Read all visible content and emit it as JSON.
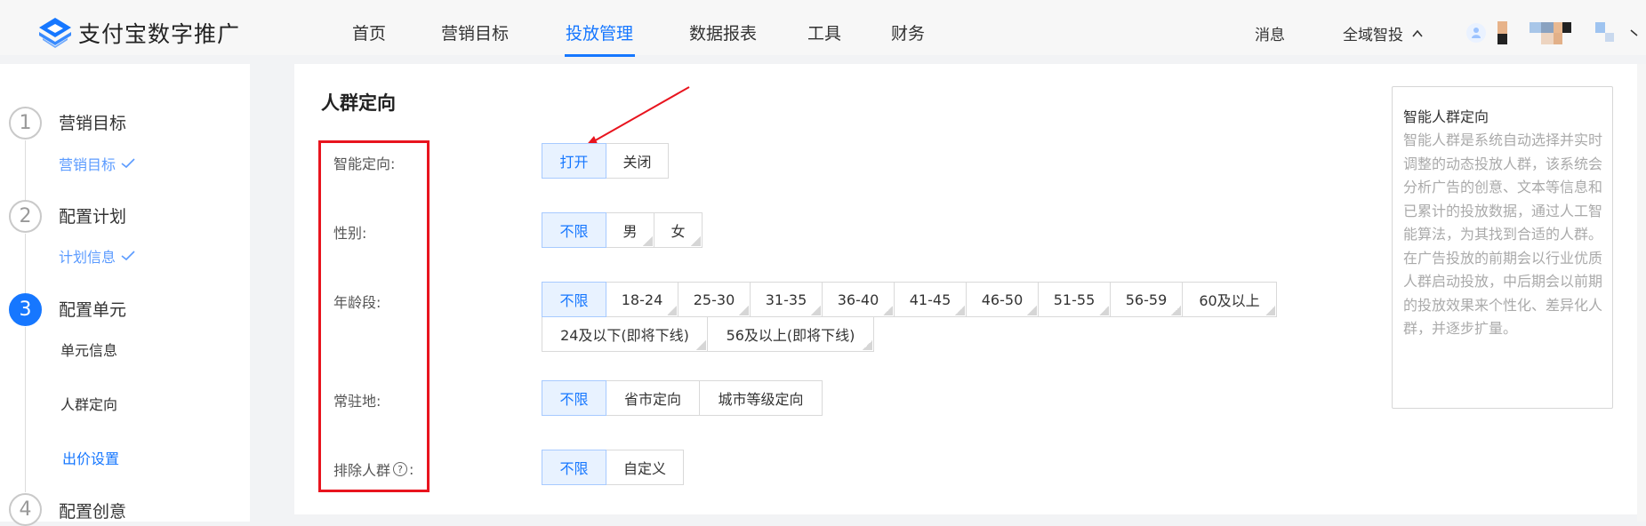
{
  "app": {
    "name": "支付宝数字推广"
  },
  "nav": {
    "items": [
      {
        "label": "首页",
        "active": false
      },
      {
        "label": "营销目标",
        "active": false
      },
      {
        "label": "投放管理",
        "active": true
      },
      {
        "label": "数据报表",
        "active": false
      },
      {
        "label": "工具",
        "active": false
      },
      {
        "label": "财务",
        "active": false
      }
    ],
    "messages": "消息",
    "scope": "全域智投",
    "scope_icon": "chevron-up-icon"
  },
  "colors": {
    "accent": "#1677ff",
    "highlight": "#e8141e",
    "accent_bg": "#e8f2ff"
  },
  "steps": [
    {
      "number": "1",
      "title": "营销目标",
      "state": "done",
      "subs": [
        {
          "label": "营销目标",
          "state": "done"
        }
      ]
    },
    {
      "number": "2",
      "title": "配置计划",
      "state": "done",
      "subs": [
        {
          "label": "计划信息",
          "state": "done"
        }
      ]
    },
    {
      "number": "3",
      "title": "配置单元",
      "state": "active",
      "subs": [
        {
          "label": "单元信息",
          "state": "normal"
        },
        {
          "label": "人群定向",
          "state": "normal"
        },
        {
          "label": "出价设置",
          "state": "link"
        }
      ]
    },
    {
      "number": "4",
      "title": "配置创意",
      "state": "pending",
      "subs": []
    }
  ],
  "section": {
    "title": "人群定向",
    "rows": {
      "smart": {
        "label": "智能定向:",
        "options": [
          "打开",
          "关闭"
        ],
        "selected": "打开"
      },
      "gender": {
        "label": "性别:",
        "options": [
          "不限",
          "男",
          "女"
        ],
        "selected": "不限"
      },
      "age": {
        "label": "年龄段:",
        "options": [
          "不限",
          "18-24",
          "25-30",
          "31-35",
          "36-40",
          "41-45",
          "46-50",
          "51-55",
          "56-59",
          "60及以上"
        ],
        "options_row2": [
          "24及以下(即将下线)",
          "56及以上(即将下线)"
        ],
        "selected": "不限"
      },
      "residence": {
        "label": "常驻地:",
        "options": [
          "不限",
          "省市定向",
          "城市等级定向"
        ],
        "selected": "不限"
      },
      "exclude": {
        "label_text": "排除人群",
        "label_suffix": ":",
        "help_glyph": "?",
        "options": [
          "不限",
          "自定义"
        ],
        "selected": "不限"
      }
    }
  },
  "help_panel": {
    "title": "智能人群定向",
    "body": "智能人群是系统自动选择并实时调整的动态投放人群，该系统会分析广告的创意、文本等信息和已累计的投放数据，通过人工智能算法，为其找到合适的人群。在广告投放的前期会以行业优质人群启动投放，中后期会以前期的投放效果来个性化、差异化人群，并逐步扩量。"
  }
}
